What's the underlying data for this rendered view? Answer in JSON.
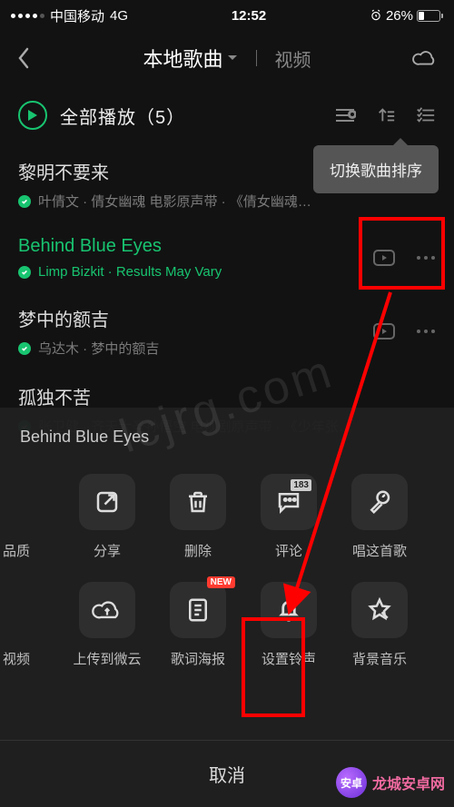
{
  "status": {
    "carrier": "中国移动",
    "network": "4G",
    "time": "12:52",
    "battery_pct": "26%"
  },
  "nav": {
    "tab_active": "本地歌曲",
    "tab_inactive": "视频"
  },
  "playall": {
    "label": "全部播放",
    "count": "（5）"
  },
  "tooltip": {
    "sort": "切换歌曲排序"
  },
  "songs": [
    {
      "title": "黎明不要来",
      "sub": "叶倩文 · 倩女幽魂 电影原声带 · 《倩女幽魂…"
    },
    {
      "title": "Behind Blue Eyes",
      "sub": "Limp Bizkit · Results May Vary"
    },
    {
      "title": "梦中的额吉",
      "sub": "乌达木 · 梦中的额吉"
    },
    {
      "title": "孤独不苦",
      "sub": "张卫健 · 齐天大圣孙悟空 电视剧原声带 · 《少年张…"
    }
  ],
  "sheet": {
    "title": "Behind Blue Eyes",
    "row1": [
      {
        "label": "品质",
        "name": "quality"
      },
      {
        "label": "分享",
        "name": "share"
      },
      {
        "label": "删除",
        "name": "delete"
      },
      {
        "label": "评论",
        "name": "comment",
        "badge": "183"
      },
      {
        "label": "唱这首歌",
        "name": "sing"
      }
    ],
    "row2": [
      {
        "label": "视频",
        "name": "video"
      },
      {
        "label": "上传到微云",
        "name": "upload-cloud"
      },
      {
        "label": "歌词海报",
        "name": "lyric-poster",
        "new": "NEW"
      },
      {
        "label": "设置铃声",
        "name": "set-ringtone"
      },
      {
        "label": "背景音乐",
        "name": "bgm"
      }
    ],
    "cancel": "取消"
  },
  "watermark": {
    "center": "lcjrg.com",
    "brand": "龙城安卓网"
  }
}
